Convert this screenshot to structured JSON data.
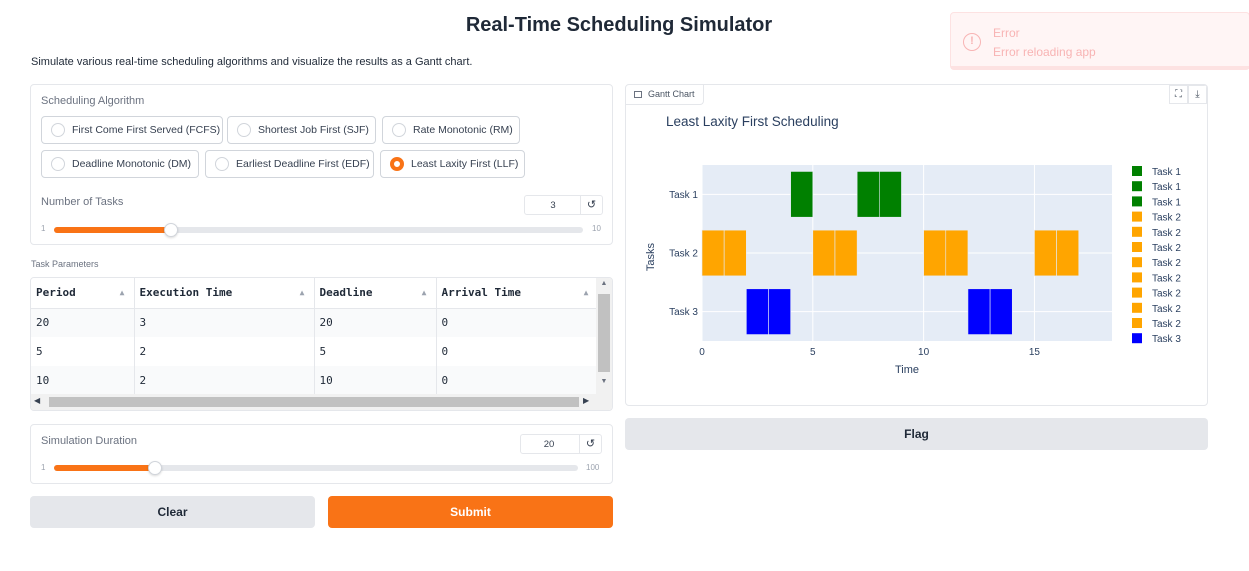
{
  "header": {
    "title": "Real-Time Scheduling Simulator",
    "description": "Simulate various real-time scheduling algorithms and visualize the results as a Gantt chart."
  },
  "toast": {
    "title": "Error",
    "message": "Error reloading app",
    "icon": "!"
  },
  "algorithm": {
    "label": "Scheduling Algorithm",
    "options": [
      "First Come First Served (FCFS)",
      "Shortest Job First (SJF)",
      "Rate Monotonic (RM)",
      "Deadline Monotonic (DM)",
      "Earliest Deadline First (EDF)",
      "Least Laxity First (LLF)"
    ],
    "selected": "Least Laxity First (LLF)"
  },
  "num_tasks": {
    "label": "Number of Tasks",
    "value": "3",
    "min": "1",
    "max": "10",
    "reset": "↺"
  },
  "task_params": {
    "label": "Task Parameters",
    "columns": [
      "Period",
      "Execution Time",
      "Deadline",
      "Arrival Time"
    ],
    "rows": [
      [
        "20",
        "3",
        "20",
        "0"
      ],
      [
        "5",
        "2",
        "5",
        "0"
      ],
      [
        "10",
        "2",
        "10",
        "0"
      ]
    ]
  },
  "duration": {
    "label": "Simulation Duration",
    "value": "20",
    "min": "1",
    "max": "100",
    "reset": "↺"
  },
  "buttons": {
    "clear": "Clear",
    "submit": "Submit",
    "flag": "Flag"
  },
  "chart_panel": {
    "label": "Gantt Chart",
    "fullscreen_icon": "⛶",
    "download_icon": "⤓"
  },
  "chart_data": {
    "type": "gantt",
    "title": "Least Laxity First Scheduling",
    "xlabel": "Time",
    "ylabel": "Tasks",
    "xlim": [
      0,
      18.5
    ],
    "xticks": [
      0,
      5,
      10,
      15
    ],
    "categories": [
      "Task 1",
      "Task 2",
      "Task 3"
    ],
    "colors": {
      "Task 1": "#008000",
      "Task 2": "#FFA500",
      "Task 3": "#0000FF"
    },
    "bars": [
      {
        "task": "Task 1",
        "start": 4,
        "end": 5
      },
      {
        "task": "Task 1",
        "start": 7,
        "end": 8
      },
      {
        "task": "Task 1",
        "start": 8,
        "end": 9
      },
      {
        "task": "Task 2",
        "start": 0,
        "end": 1
      },
      {
        "task": "Task 2",
        "start": 1,
        "end": 2
      },
      {
        "task": "Task 2",
        "start": 5,
        "end": 6
      },
      {
        "task": "Task 2",
        "start": 6,
        "end": 7
      },
      {
        "task": "Task 2",
        "start": 10,
        "end": 11
      },
      {
        "task": "Task 2",
        "start": 11,
        "end": 12
      },
      {
        "task": "Task 2",
        "start": 15,
        "end": 16
      },
      {
        "task": "Task 2",
        "start": 16,
        "end": 17
      },
      {
        "task": "Task 3",
        "start": 2,
        "end": 3
      },
      {
        "task": "Task 3",
        "start": 3,
        "end": 4
      },
      {
        "task": "Task 3",
        "start": 12,
        "end": 13
      },
      {
        "task": "Task 3",
        "start": 13,
        "end": 14
      }
    ],
    "legend": [
      "Task 1",
      "Task 1",
      "Task 1",
      "Task 2",
      "Task 2",
      "Task 2",
      "Task 2",
      "Task 2",
      "Task 2",
      "Task 2",
      "Task 2",
      "Task 3"
    ],
    "legend_position": "right"
  }
}
